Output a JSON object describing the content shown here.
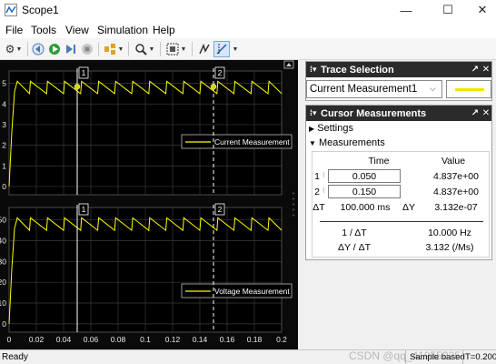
{
  "window": {
    "title": "Scope1",
    "minimize": "—",
    "maximize": "☐",
    "close": "✕"
  },
  "menu": [
    "File",
    "Tools",
    "View",
    "Simulation",
    "Help"
  ],
  "plots": {
    "time_ticks": [
      "0",
      "0.02",
      "0.04",
      "0.06",
      "0.08",
      "0.1",
      "0.12",
      "0.14",
      "0.16",
      "0.18",
      "0.2"
    ],
    "top": {
      "legend": "Current Measurement",
      "yticks": [
        "0",
        "1",
        "2",
        "3",
        "4",
        "5"
      ]
    },
    "bottom": {
      "legend": "Voltage Measurement",
      "yticks": [
        "0",
        "10",
        "20",
        "30",
        "40",
        "50"
      ]
    },
    "cursor1_label": "1",
    "cursor2_label": "2",
    "trace_color": "#ffff00"
  },
  "trace_selection": {
    "title": "Trace Selection",
    "selected": "Current Measurement1"
  },
  "cursor_measurements": {
    "title": "Cursor Measurements",
    "settings_label": "Settings",
    "measurements_label": "Measurements",
    "col_time": "Time",
    "col_value": "Value",
    "row1": {
      "label": "1",
      "time": "0.050",
      "value": "4.837e+00"
    },
    "row2": {
      "label": "2",
      "time": "0.150",
      "value": "4.837e+00"
    },
    "delta_t_label": "ΔT",
    "delta_t": "100.000 ms",
    "delta_y_label": "ΔY",
    "delta_y": "3.132e-07",
    "inv_dt_label": "1 / ΔT",
    "inv_dt": "10.000 Hz",
    "dy_dt_label": "ΔY / ΔT",
    "dy_dt": "3.132 (/Ms)"
  },
  "status": {
    "left": "Ready",
    "mode": "Sample based",
    "time": "T=0.200",
    "watermark": "CSDN @qq_41955225"
  }
}
